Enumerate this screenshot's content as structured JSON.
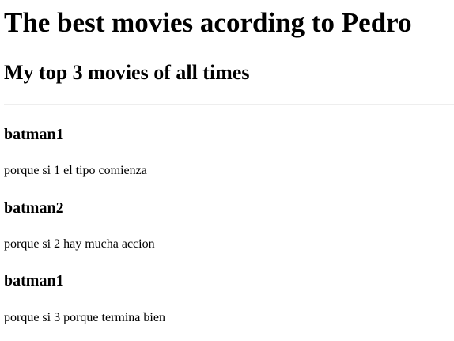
{
  "page": {
    "title": "The best movies acording to Pedro",
    "subtitle": "My top 3 movies of all times"
  },
  "movies": [
    {
      "title": "batman1",
      "reason": "porque si 1 el tipo comienza"
    },
    {
      "title": "batman2",
      "reason": "porque si 2 hay mucha accion"
    },
    {
      "title": "batman1",
      "reason": "porque si 3 porque termina bien"
    }
  ]
}
